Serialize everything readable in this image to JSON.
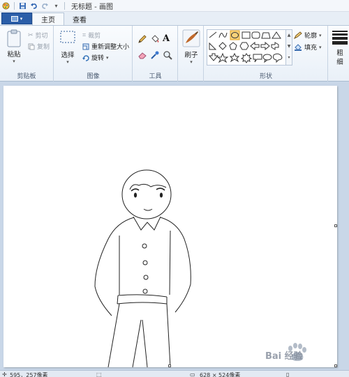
{
  "window": {
    "title": "无标题 - 画图"
  },
  "tabs": [
    {
      "label": "主页"
    },
    {
      "label": "查看"
    }
  ],
  "clipboard": {
    "paste": "粘贴",
    "cut": "剪切",
    "copy": "复制",
    "group": "剪贴板"
  },
  "image": {
    "select": "选择",
    "crop": "裁剪",
    "resize": "重新调整大小",
    "rotate": "旋转",
    "group": "图像"
  },
  "tools": {
    "group": "工具"
  },
  "brushes": {
    "label": "刷子"
  },
  "shapes": {
    "outline": "轮廓",
    "fill": "填充",
    "group": "形状"
  },
  "size": {
    "label": "粗\n细"
  },
  "status": {
    "cursor": "595，257像素",
    "size": "628 × 524像素"
  },
  "watermark": {
    "text": "Bai 经验"
  }
}
